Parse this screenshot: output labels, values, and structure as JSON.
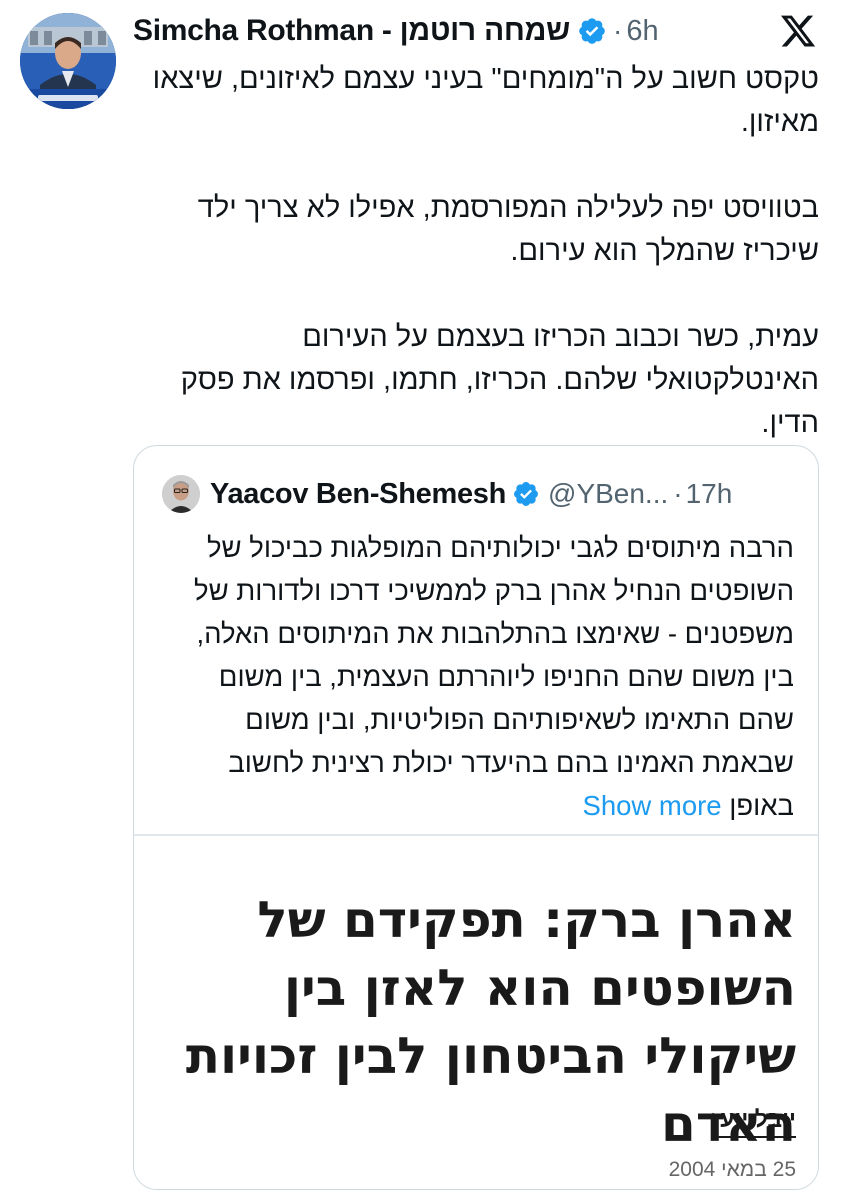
{
  "tweet": {
    "author_name": "Simcha Rothman - שמחה רוטמן",
    "time": "6h",
    "dot": "·",
    "paragraphs": [
      "טקסט חשוב על ה\"מומחים\" בעיני עצמם לאיזונים, שיצאו מאיזון.",
      "בטוויסט יפה לעלילה המפורסמת, אפילו לא צריך ילד שיכריז שהמלך הוא עירום.",
      "עמית, כשר וכבוב הכריזו בעצמם על העירום האינטלקטואלי שלהם. הכריזו, חתמו, ופרסמו את פסק הדין."
    ],
    "icons": {
      "avatar": "profile-photo",
      "verified": "verified-badge-icon",
      "platform": "x-logo-icon"
    }
  },
  "quote": {
    "author_name": "Yaacov Ben-Shemesh",
    "handle": "@YBen...",
    "dot": "·",
    "time": "17h",
    "text": "הרבה מיתוסים לגבי יכולותיהם המופלגות כביכול של השופטים הנחיל אהרן ברק לממשיכי דרכו ולדורות של משפטנים - שאימצו בהתלהבות את המיתוסים האלה, בין משום שהם החניפו ליוהרתם העצמית, בין משום שהם התאימו לשאיפותיהם הפוליטיות, ובין משום שבאמת האמינו בהם בהיעדר יכולת רצינית לחשוב באופן",
    "show_more": "Show more",
    "article": {
      "headline": "אהרן ברק: תפקידם של השופטים הוא לאזן בין שיקולי הביטחון לבין זכויות האדם",
      "author": "יובל יועז",
      "date": "25 במאי 2004"
    }
  },
  "colors": {
    "text": "#0f1419",
    "secondary": "#536471",
    "link": "#1d9bf0",
    "verified": "#1d9bf0",
    "border": "#cfd9de"
  }
}
